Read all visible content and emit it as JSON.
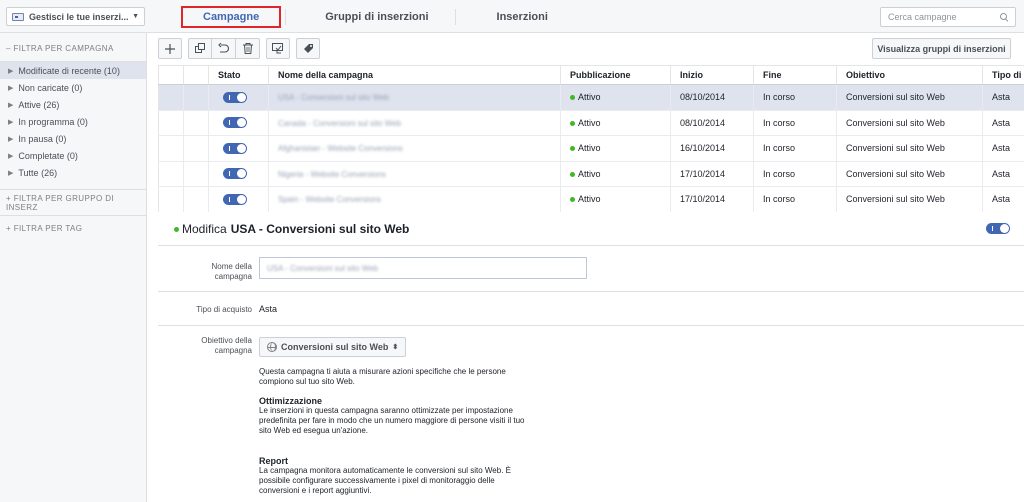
{
  "topbar": {
    "manage_label": "Gestisci le tue inserzi...",
    "tabs": [
      "Campagne",
      "Gruppi di inserzioni",
      "Inserzioni"
    ],
    "search_placeholder": "Cerca campagne"
  },
  "sidebar": {
    "campaign_filter_heading": "– FILTRA PER CAMPAGNA",
    "items": [
      "Modificate di recente (10)",
      "Non caricate (0)",
      "Attive (26)",
      "In programma (0)",
      "In pausa (0)",
      "Completate (0)",
      "Tutte (26)"
    ],
    "adgroup_filter_heading": "+ FILTRA PER GRUPPO DI INSERZ",
    "tag_filter_heading": "+ FILTRA PER TAG"
  },
  "toolbar": {
    "icons": [
      "plus-icon",
      "duplicate-icon",
      "undo-icon",
      "trash-icon",
      "export-icon",
      "tag-icon"
    ],
    "view_groups_label": "Visualizza gruppi di inserzioni"
  },
  "table": {
    "headers": [
      "Stato",
      "Nome della campagna",
      "Pubblicazione",
      "Inizio",
      "Fine",
      "Obiettivo",
      "Tipo di a"
    ],
    "rows": [
      {
        "name": "USA - Conversioni sul sito Web",
        "status": "Attivo",
        "start": "08/10/2014",
        "end": "In corso",
        "objective": "Conversioni sul sito Web",
        "buy_type": "Asta"
      },
      {
        "name": "Canada - Conversioni sul sito Web",
        "status": "Attivo",
        "start": "08/10/2014",
        "end": "In corso",
        "objective": "Conversioni sul sito Web",
        "buy_type": "Asta"
      },
      {
        "name": "Afghanistan - Website Conversions",
        "status": "Attivo",
        "start": "16/10/2014",
        "end": "In corso",
        "objective": "Conversioni sul sito Web",
        "buy_type": "Asta"
      },
      {
        "name": "Nigeria - Website Conversions",
        "status": "Attivo",
        "start": "17/10/2014",
        "end": "In corso",
        "objective": "Conversioni sul sito Web",
        "buy_type": "Asta"
      },
      {
        "name": "Spain - Website Conversions",
        "status": "Attivo",
        "start": "17/10/2014",
        "end": "In corso",
        "objective": "Conversioni sul sito Web",
        "buy_type": "Asta"
      }
    ]
  },
  "edit": {
    "title_prefix": "Modifica",
    "title_name": "USA - Conversioni sul sito Web",
    "name_label": "Nome della campagna",
    "name_value": "USA - Conversioni sul sito Web",
    "buy_type_label": "Tipo di acquisto",
    "buy_type_value": "Asta",
    "objective_label": "Obiettivo della campagna",
    "objective_value": "Conversioni sul sito Web",
    "objective_desc": "Questa campagna ti aiuta a misurare azioni specifiche che le persone compiono sul tuo sito Web.",
    "optimization_heading": "Ottimizzazione",
    "optimization_text": "Le inserzioni in questa campagna saranno ottimizzate per impostazione predefinita per fare in modo che un numero maggiore di persone visiti il tuo sito Web ed esegua un'azione.",
    "report_heading": "Report",
    "report_text": "La campagna monitora automaticamente le conversioni sul sito Web. È possibile configurare successivamente i pixel di monitoraggio delle conversioni e i report aggiuntivi."
  }
}
